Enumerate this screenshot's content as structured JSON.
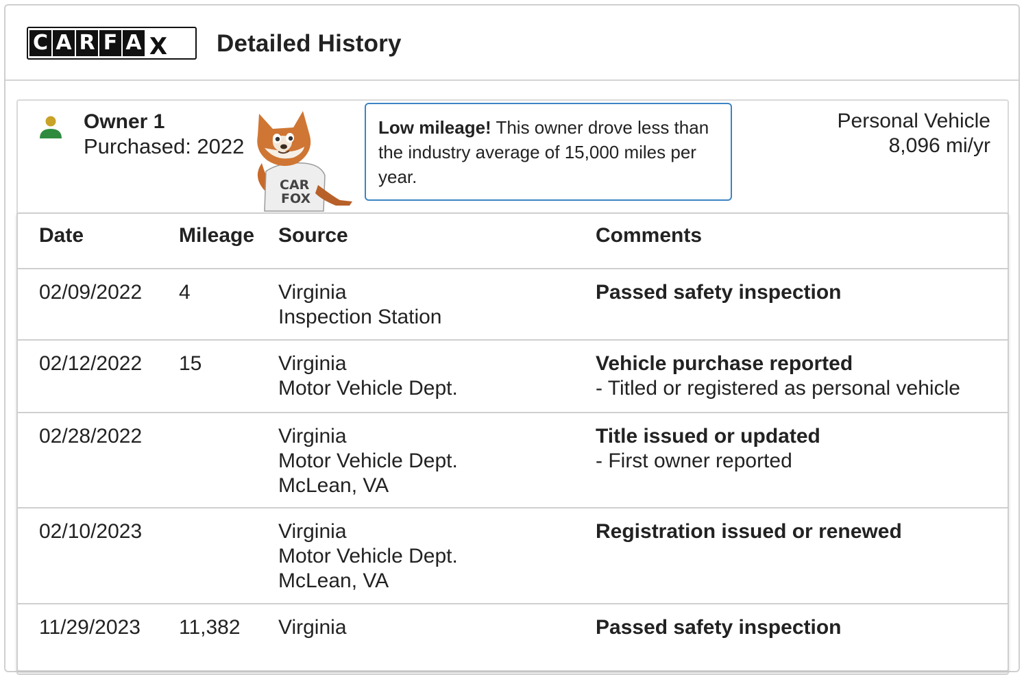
{
  "header": {
    "logo_letters": [
      "C",
      "A",
      "R",
      "F",
      "A",
      "X"
    ],
    "title": "Detailed History"
  },
  "owner": {
    "name": "Owner 1",
    "purchased": "Purchased: 2022",
    "icon": "person-icon",
    "icon_colors": {
      "head": "#c9a227",
      "body": "#2e8b3e"
    },
    "mascot": "carfox-mascot",
    "mascot_shirt_text": "CAR FOX"
  },
  "callout": {
    "bold_text": "Low mileage!",
    "text": " This owner drove less than the industry average of 15,000 miles per year."
  },
  "vehicle": {
    "type": "Personal Vehicle",
    "miles_per_year": "8,096 mi/yr"
  },
  "table": {
    "columns": [
      "Date",
      "Mileage",
      "Source",
      "Comments"
    ],
    "rows": [
      {
        "date": "02/09/2022",
        "mileage": "4",
        "source": [
          "Virginia",
          "Inspection Station"
        ],
        "comment": "Passed safety inspection",
        "detail": ""
      },
      {
        "date": "02/12/2022",
        "mileage": "15",
        "source": [
          "Virginia",
          "Motor Vehicle Dept."
        ],
        "comment": "Vehicle purchase reported",
        "detail": "- Titled or registered as personal vehicle"
      },
      {
        "date": "02/28/2022",
        "mileage": "",
        "source": [
          "Virginia",
          "Motor Vehicle Dept.",
          "McLean, VA"
        ],
        "comment": "Title issued or updated",
        "detail": "- First owner reported"
      },
      {
        "date": "02/10/2023",
        "mileage": "",
        "source": [
          "Virginia",
          "Motor Vehicle Dept.",
          "McLean, VA"
        ],
        "comment": "Registration issued or renewed",
        "detail": ""
      },
      {
        "date": "11/29/2023",
        "mileage": "11,382",
        "source": [
          "Virginia"
        ],
        "comment": "Passed safety inspection",
        "detail": ""
      }
    ]
  },
  "colors": {
    "callout_border": "#3b84c4",
    "border": "#cfcfcf"
  }
}
